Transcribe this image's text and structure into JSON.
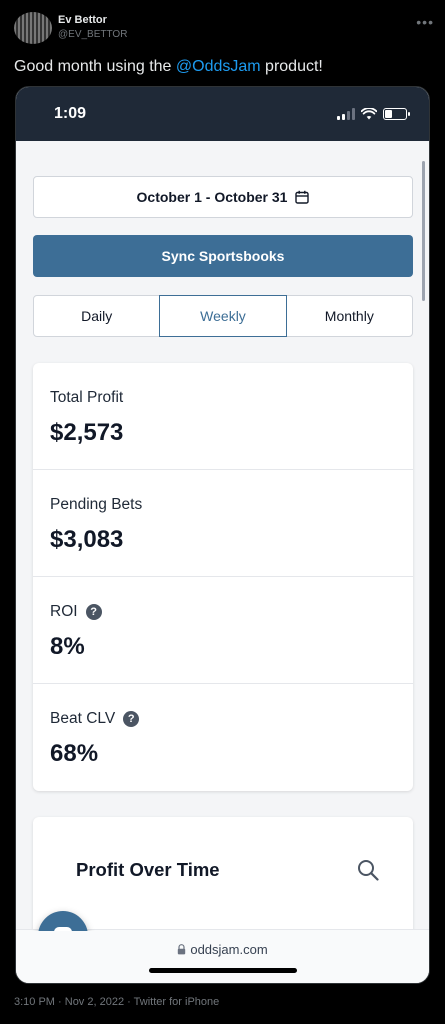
{
  "tweet": {
    "author_name": "Ev Bettor",
    "author_handle": "@EV_BETTOR",
    "more_icon": "more-horizontal-icon",
    "text_before": "Good month using the ",
    "mention": "@OddsJam",
    "text_after": " product!",
    "timestamp": "3:10 PM",
    "date": "Nov 2, 2022",
    "source": "Twitter for iPhone"
  },
  "status_bar": {
    "time": "1:09",
    "icons": [
      "signal-icon",
      "wifi-icon",
      "battery-icon"
    ],
    "battery_level": 0.35
  },
  "app": {
    "date_range": "October 1 - October 31",
    "date_icon": "calendar-icon",
    "sync_button": "Sync Sportsbooks",
    "period_tabs": [
      {
        "label": "Daily",
        "active": false
      },
      {
        "label": "Weekly",
        "active": true
      },
      {
        "label": "Monthly",
        "active": false
      }
    ],
    "stats": [
      {
        "label": "Total Profit",
        "value": "$2,573",
        "help": false
      },
      {
        "label": "Pending Bets",
        "value": "$3,083",
        "help": false
      },
      {
        "label": "ROI",
        "value": "8%",
        "help": true
      },
      {
        "label": "Beat CLV",
        "value": "68%",
        "help": true
      }
    ],
    "help_glyph": "?",
    "chart_title": "Profit Over Time",
    "chart_search_icon": "search-icon",
    "chat_icon": "chat-bubble-icon"
  },
  "browser": {
    "url": "oddsjam.com",
    "lock_icon": "lock-icon"
  },
  "colors": {
    "accent": "#3d6e96",
    "mention": "#1d9bf0",
    "status_bar": "#1f2937"
  }
}
